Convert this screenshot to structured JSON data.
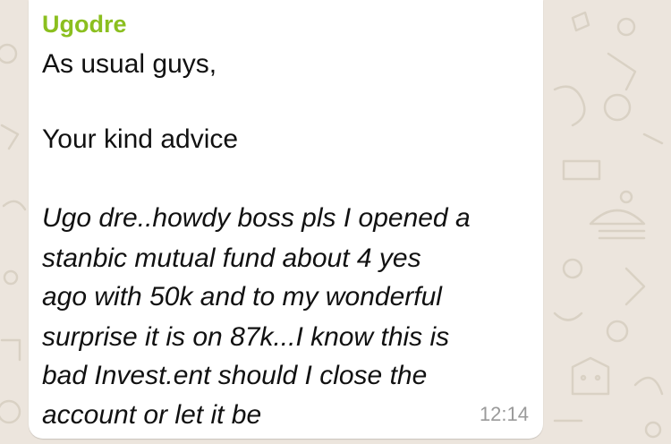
{
  "chat": {
    "background_color": "#ece5dd",
    "message": {
      "sender": "Ugodre",
      "sender_color": "#8bbf1f",
      "lines": {
        "l1": "As usual guys,",
        "l2": "Your kind advice",
        "l3": "Ugo dre..howdy boss pls I opened a",
        "l4": "stanbic mutual fund about 4 yes",
        "l5": "ago with 50k and to my wonderful",
        "l6": "surprise it is on 87k...I know this is",
        "l7": "bad Invest.ent should I close the",
        "l8": "account or let it be"
      },
      "timestamp": "12:14"
    }
  }
}
